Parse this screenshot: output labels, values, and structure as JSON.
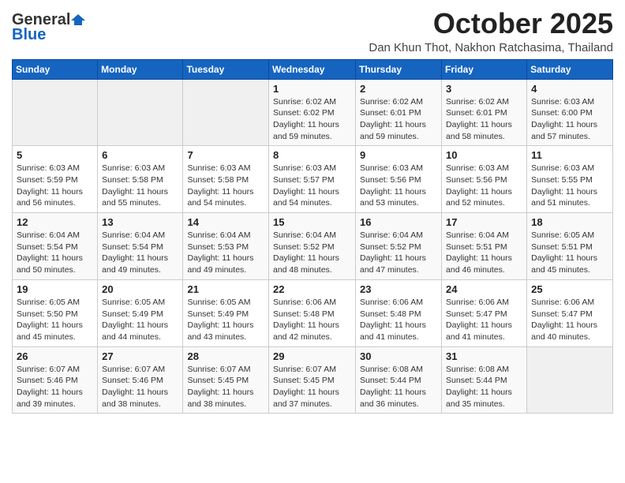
{
  "header": {
    "logo_general": "General",
    "logo_blue": "Blue",
    "month_title": "October 2025",
    "location": "Dan Khun Thot, Nakhon Ratchasima, Thailand"
  },
  "weekdays": [
    "Sunday",
    "Monday",
    "Tuesday",
    "Wednesday",
    "Thursday",
    "Friday",
    "Saturday"
  ],
  "weeks": [
    [
      {
        "day": "",
        "info": ""
      },
      {
        "day": "",
        "info": ""
      },
      {
        "day": "",
        "info": ""
      },
      {
        "day": "1",
        "info": "Sunrise: 6:02 AM\nSunset: 6:02 PM\nDaylight: 11 hours\nand 59 minutes."
      },
      {
        "day": "2",
        "info": "Sunrise: 6:02 AM\nSunset: 6:01 PM\nDaylight: 11 hours\nand 59 minutes."
      },
      {
        "day": "3",
        "info": "Sunrise: 6:02 AM\nSunset: 6:01 PM\nDaylight: 11 hours\nand 58 minutes."
      },
      {
        "day": "4",
        "info": "Sunrise: 6:03 AM\nSunset: 6:00 PM\nDaylight: 11 hours\nand 57 minutes."
      }
    ],
    [
      {
        "day": "5",
        "info": "Sunrise: 6:03 AM\nSunset: 5:59 PM\nDaylight: 11 hours\nand 56 minutes."
      },
      {
        "day": "6",
        "info": "Sunrise: 6:03 AM\nSunset: 5:58 PM\nDaylight: 11 hours\nand 55 minutes."
      },
      {
        "day": "7",
        "info": "Sunrise: 6:03 AM\nSunset: 5:58 PM\nDaylight: 11 hours\nand 54 minutes."
      },
      {
        "day": "8",
        "info": "Sunrise: 6:03 AM\nSunset: 5:57 PM\nDaylight: 11 hours\nand 54 minutes."
      },
      {
        "day": "9",
        "info": "Sunrise: 6:03 AM\nSunset: 5:56 PM\nDaylight: 11 hours\nand 53 minutes."
      },
      {
        "day": "10",
        "info": "Sunrise: 6:03 AM\nSunset: 5:56 PM\nDaylight: 11 hours\nand 52 minutes."
      },
      {
        "day": "11",
        "info": "Sunrise: 6:03 AM\nSunset: 5:55 PM\nDaylight: 11 hours\nand 51 minutes."
      }
    ],
    [
      {
        "day": "12",
        "info": "Sunrise: 6:04 AM\nSunset: 5:54 PM\nDaylight: 11 hours\nand 50 minutes."
      },
      {
        "day": "13",
        "info": "Sunrise: 6:04 AM\nSunset: 5:54 PM\nDaylight: 11 hours\nand 49 minutes."
      },
      {
        "day": "14",
        "info": "Sunrise: 6:04 AM\nSunset: 5:53 PM\nDaylight: 11 hours\nand 49 minutes."
      },
      {
        "day": "15",
        "info": "Sunrise: 6:04 AM\nSunset: 5:52 PM\nDaylight: 11 hours\nand 48 minutes."
      },
      {
        "day": "16",
        "info": "Sunrise: 6:04 AM\nSunset: 5:52 PM\nDaylight: 11 hours\nand 47 minutes."
      },
      {
        "day": "17",
        "info": "Sunrise: 6:04 AM\nSunset: 5:51 PM\nDaylight: 11 hours\nand 46 minutes."
      },
      {
        "day": "18",
        "info": "Sunrise: 6:05 AM\nSunset: 5:51 PM\nDaylight: 11 hours\nand 45 minutes."
      }
    ],
    [
      {
        "day": "19",
        "info": "Sunrise: 6:05 AM\nSunset: 5:50 PM\nDaylight: 11 hours\nand 45 minutes."
      },
      {
        "day": "20",
        "info": "Sunrise: 6:05 AM\nSunset: 5:49 PM\nDaylight: 11 hours\nand 44 minutes."
      },
      {
        "day": "21",
        "info": "Sunrise: 6:05 AM\nSunset: 5:49 PM\nDaylight: 11 hours\nand 43 minutes."
      },
      {
        "day": "22",
        "info": "Sunrise: 6:06 AM\nSunset: 5:48 PM\nDaylight: 11 hours\nand 42 minutes."
      },
      {
        "day": "23",
        "info": "Sunrise: 6:06 AM\nSunset: 5:48 PM\nDaylight: 11 hours\nand 41 minutes."
      },
      {
        "day": "24",
        "info": "Sunrise: 6:06 AM\nSunset: 5:47 PM\nDaylight: 11 hours\nand 41 minutes."
      },
      {
        "day": "25",
        "info": "Sunrise: 6:06 AM\nSunset: 5:47 PM\nDaylight: 11 hours\nand 40 minutes."
      }
    ],
    [
      {
        "day": "26",
        "info": "Sunrise: 6:07 AM\nSunset: 5:46 PM\nDaylight: 11 hours\nand 39 minutes."
      },
      {
        "day": "27",
        "info": "Sunrise: 6:07 AM\nSunset: 5:46 PM\nDaylight: 11 hours\nand 38 minutes."
      },
      {
        "day": "28",
        "info": "Sunrise: 6:07 AM\nSunset: 5:45 PM\nDaylight: 11 hours\nand 38 minutes."
      },
      {
        "day": "29",
        "info": "Sunrise: 6:07 AM\nSunset: 5:45 PM\nDaylight: 11 hours\nand 37 minutes."
      },
      {
        "day": "30",
        "info": "Sunrise: 6:08 AM\nSunset: 5:44 PM\nDaylight: 11 hours\nand 36 minutes."
      },
      {
        "day": "31",
        "info": "Sunrise: 6:08 AM\nSunset: 5:44 PM\nDaylight: 11 hours\nand 35 minutes."
      },
      {
        "day": "",
        "info": ""
      }
    ]
  ]
}
